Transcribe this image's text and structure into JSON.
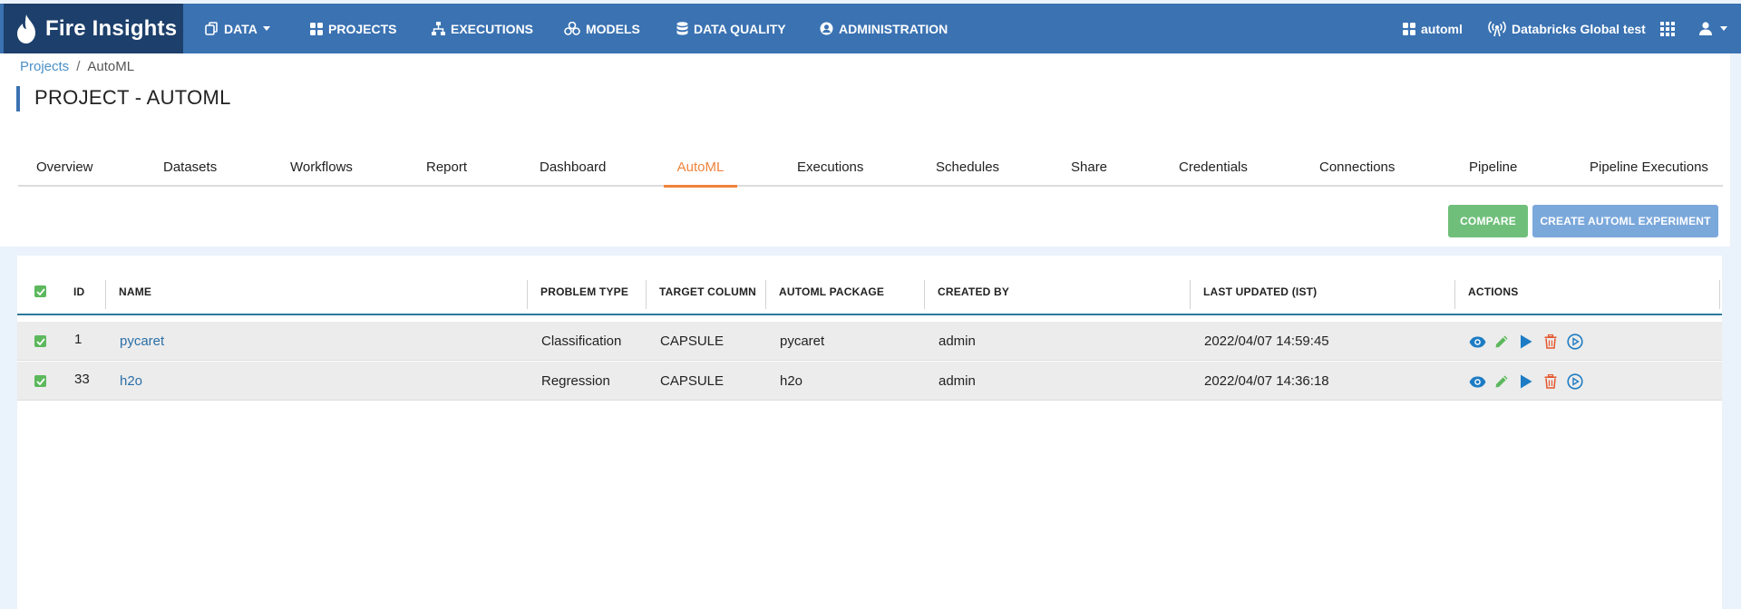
{
  "navbar": {
    "brand": "Fire Insights",
    "items": [
      {
        "label": "DATA",
        "icon": "copy-icon",
        "has_caret": true
      },
      {
        "label": "PROJECTS",
        "icon": "grid-icon"
      },
      {
        "label": "EXECUTIONS",
        "icon": "sitemap-icon"
      },
      {
        "label": "MODELS",
        "icon": "cubes-icon"
      },
      {
        "label": "DATA QUALITY",
        "icon": "database-icon"
      },
      {
        "label": "ADMINISTRATION",
        "icon": "user-circle-icon"
      }
    ],
    "right": {
      "project": "automl",
      "cluster": "Databricks Global test"
    }
  },
  "breadcrumb": {
    "root": "Projects",
    "separator": "/",
    "current": "AutoML"
  },
  "page_title": "PROJECT - AUTOML",
  "tabs": [
    "Overview",
    "Datasets",
    "Workflows",
    "Report",
    "Dashboard",
    "AutoML",
    "Executions",
    "Schedules",
    "Share",
    "Credentials",
    "Connections",
    "Pipeline",
    "Pipeline Executions"
  ],
  "active_tab": "AutoML",
  "buttons": {
    "compare": "COMPARE",
    "create": "CREATE AUTOML EXPERIMENT"
  },
  "table": {
    "headers": {
      "id": "ID",
      "name": "NAME",
      "problem_type": "PROBLEM TYPE",
      "target_column": "TARGET COLUMN",
      "automl_package": "AUTOML PACKAGE",
      "created_by": "CREATED BY",
      "last_updated": "LAST UPDATED (IST)",
      "actions": "ACTIONS"
    },
    "rows": [
      {
        "id": "1",
        "name": "pycaret",
        "problem_type": "Classification",
        "target_column": "CAPSULE",
        "automl_package": "pycaret",
        "created_by": "admin",
        "last_updated": "2022/04/07 14:59:45"
      },
      {
        "id": "33",
        "name": "h2o",
        "problem_type": "Regression",
        "target_column": "CAPSULE",
        "automl_package": "h2o",
        "created_by": "admin",
        "last_updated": "2022/04/07 14:36:18"
      }
    ],
    "action_icons": [
      "eye-icon",
      "pencil-icon",
      "play-icon",
      "trash-icon",
      "play-circle-icon"
    ]
  },
  "colors": {
    "navbar": "#3a72b2",
    "brand_bg": "#1d3f6b",
    "accent_active_tab": "#f0833a",
    "compare_button": "#6fbf7a",
    "create_button": "#7ba8db",
    "link": "#2a6fa8",
    "checkbox": "#5cb85c"
  }
}
